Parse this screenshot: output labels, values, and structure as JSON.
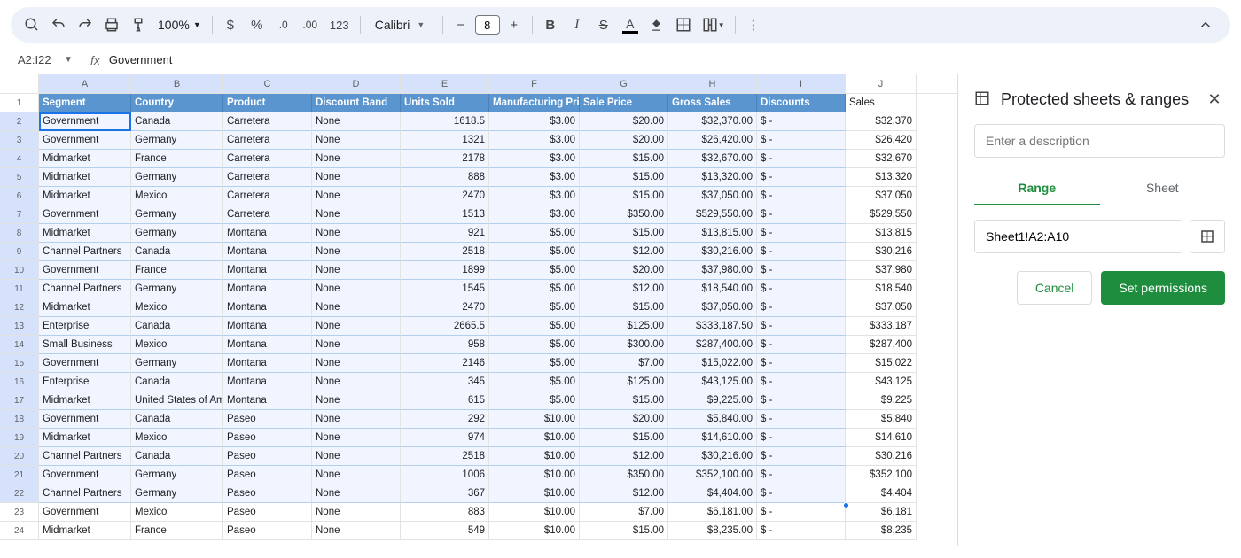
{
  "toolbar": {
    "zoom": "100%",
    "font": "Calibri",
    "font_size": "8",
    "num_format": "123"
  },
  "name_box": "A2:I22",
  "formula": "Government",
  "columns": [
    "A",
    "B",
    "C",
    "D",
    "E",
    "F",
    "G",
    "H",
    "I",
    "J"
  ],
  "headers": [
    "Segment",
    "Country",
    "Product",
    "Discount Band",
    "Units Sold",
    "Manufacturing Price",
    "Sale Price",
    "Gross Sales",
    "Discounts",
    "Sales"
  ],
  "rows": [
    {
      "n": 2,
      "seg": "Government",
      "cty": "Canada",
      "prod": "Carretera",
      "disc": "None",
      "units": "1618.5",
      "mfg": "$3.00",
      "sale": "$20.00",
      "gross": "$32,370.00",
      "discv": "$ -",
      "sales": "$32,370"
    },
    {
      "n": 3,
      "seg": "Government",
      "cty": "Germany",
      "prod": "Carretera",
      "disc": "None",
      "units": "1321",
      "mfg": "$3.00",
      "sale": "$20.00",
      "gross": "$26,420.00",
      "discv": "$ -",
      "sales": "$26,420"
    },
    {
      "n": 4,
      "seg": "Midmarket",
      "cty": "France",
      "prod": "Carretera",
      "disc": "None",
      "units": "2178",
      "mfg": "$3.00",
      "sale": "$15.00",
      "gross": "$32,670.00",
      "discv": "$ -",
      "sales": "$32,670"
    },
    {
      "n": 5,
      "seg": "Midmarket",
      "cty": "Germany",
      "prod": "Carretera",
      "disc": "None",
      "units": "888",
      "mfg": "$3.00",
      "sale": "$15.00",
      "gross": "$13,320.00",
      "discv": "$ -",
      "sales": "$13,320"
    },
    {
      "n": 6,
      "seg": "Midmarket",
      "cty": "Mexico",
      "prod": "Carretera",
      "disc": "None",
      "units": "2470",
      "mfg": "$3.00",
      "sale": "$15.00",
      "gross": "$37,050.00",
      "discv": "$ -",
      "sales": "$37,050"
    },
    {
      "n": 7,
      "seg": "Government",
      "cty": "Germany",
      "prod": "Carretera",
      "disc": "None",
      "units": "1513",
      "mfg": "$3.00",
      "sale": "$350.00",
      "gross": "$529,550.00",
      "discv": "$ -",
      "sales": "$529,550"
    },
    {
      "n": 8,
      "seg": "Midmarket",
      "cty": "Germany",
      "prod": "Montana",
      "disc": "None",
      "units": "921",
      "mfg": "$5.00",
      "sale": "$15.00",
      "gross": "$13,815.00",
      "discv": "$ -",
      "sales": "$13,815"
    },
    {
      "n": 9,
      "seg": "Channel Partners",
      "cty": "Canada",
      "prod": "Montana",
      "disc": "None",
      "units": "2518",
      "mfg": "$5.00",
      "sale": "$12.00",
      "gross": "$30,216.00",
      "discv": "$ -",
      "sales": "$30,216"
    },
    {
      "n": 10,
      "seg": "Government",
      "cty": "France",
      "prod": "Montana",
      "disc": "None",
      "units": "1899",
      "mfg": "$5.00",
      "sale": "$20.00",
      "gross": "$37,980.00",
      "discv": "$ -",
      "sales": "$37,980"
    },
    {
      "n": 11,
      "seg": "Channel Partners",
      "cty": "Germany",
      "prod": "Montana",
      "disc": "None",
      "units": "1545",
      "mfg": "$5.00",
      "sale": "$12.00",
      "gross": "$18,540.00",
      "discv": "$ -",
      "sales": "$18,540"
    },
    {
      "n": 12,
      "seg": "Midmarket",
      "cty": "Mexico",
      "prod": "Montana",
      "disc": "None",
      "units": "2470",
      "mfg": "$5.00",
      "sale": "$15.00",
      "gross": "$37,050.00",
      "discv": "$ -",
      "sales": "$37,050"
    },
    {
      "n": 13,
      "seg": "Enterprise",
      "cty": "Canada",
      "prod": "Montana",
      "disc": "None",
      "units": "2665.5",
      "mfg": "$5.00",
      "sale": "$125.00",
      "gross": "$333,187.50",
      "discv": "$ -",
      "sales": "$333,187"
    },
    {
      "n": 14,
      "seg": "Small Business",
      "cty": "Mexico",
      "prod": "Montana",
      "disc": "None",
      "units": "958",
      "mfg": "$5.00",
      "sale": "$300.00",
      "gross": "$287,400.00",
      "discv": "$ -",
      "sales": "$287,400"
    },
    {
      "n": 15,
      "seg": "Government",
      "cty": "Germany",
      "prod": "Montana",
      "disc": "None",
      "units": "2146",
      "mfg": "$5.00",
      "sale": "$7.00",
      "gross": "$15,022.00",
      "discv": "$ -",
      "sales": "$15,022"
    },
    {
      "n": 16,
      "seg": "Enterprise",
      "cty": "Canada",
      "prod": "Montana",
      "disc": "None",
      "units": "345",
      "mfg": "$5.00",
      "sale": "$125.00",
      "gross": "$43,125.00",
      "discv": "$ -",
      "sales": "$43,125"
    },
    {
      "n": 17,
      "seg": "Midmarket",
      "cty": "United States of Ameri",
      "prod": "Montana",
      "disc": "None",
      "units": "615",
      "mfg": "$5.00",
      "sale": "$15.00",
      "gross": "$9,225.00",
      "discv": "$ -",
      "sales": "$9,225"
    },
    {
      "n": 18,
      "seg": "Government",
      "cty": "Canada",
      "prod": "Paseo",
      "disc": "None",
      "units": "292",
      "mfg": "$10.00",
      "sale": "$20.00",
      "gross": "$5,840.00",
      "discv": "$ -",
      "sales": "$5,840"
    },
    {
      "n": 19,
      "seg": "Midmarket",
      "cty": "Mexico",
      "prod": "Paseo",
      "disc": "None",
      "units": "974",
      "mfg": "$10.00",
      "sale": "$15.00",
      "gross": "$14,610.00",
      "discv": "$ -",
      "sales": "$14,610"
    },
    {
      "n": 20,
      "seg": "Channel Partners",
      "cty": "Canada",
      "prod": "Paseo",
      "disc": "None",
      "units": "2518",
      "mfg": "$10.00",
      "sale": "$12.00",
      "gross": "$30,216.00",
      "discv": "$ -",
      "sales": "$30,216"
    },
    {
      "n": 21,
      "seg": "Government",
      "cty": "Germany",
      "prod": "Paseo",
      "disc": "None",
      "units": "1006",
      "mfg": "$10.00",
      "sale": "$350.00",
      "gross": "$352,100.00",
      "discv": "$ -",
      "sales": "$352,100"
    },
    {
      "n": 22,
      "seg": "Channel Partners",
      "cty": "Germany",
      "prod": "Paseo",
      "disc": "None",
      "units": "367",
      "mfg": "$10.00",
      "sale": "$12.00",
      "gross": "$4,404.00",
      "discv": "$ -",
      "sales": "$4,404"
    },
    {
      "n": 23,
      "seg": "Government",
      "cty": "Mexico",
      "prod": "Paseo",
      "disc": "None",
      "units": "883",
      "mfg": "$10.00",
      "sale": "$7.00",
      "gross": "$6,181.00",
      "discv": "$ -",
      "sales": "$6,181"
    },
    {
      "n": 24,
      "seg": "Midmarket",
      "cty": "France",
      "prod": "Paseo",
      "disc": "None",
      "units": "549",
      "mfg": "$10.00",
      "sale": "$15.00",
      "gross": "$8,235.00",
      "discv": "$ -",
      "sales": "$8,235"
    }
  ],
  "panel": {
    "title": "Protected sheets & ranges",
    "desc_placeholder": "Enter a description",
    "tab_range": "Range",
    "tab_sheet": "Sheet",
    "range_value": "Sheet1!A2:A10",
    "cancel": "Cancel",
    "set_permissions": "Set permissions"
  }
}
